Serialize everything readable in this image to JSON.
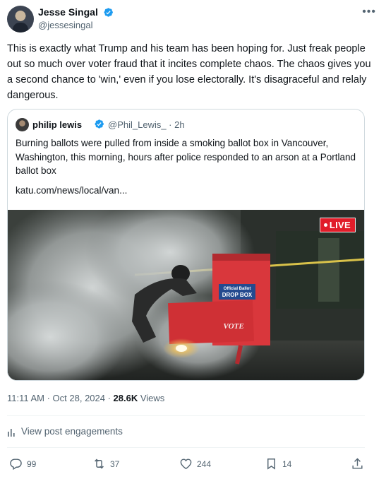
{
  "author": {
    "name": "Jesse Singal",
    "handle": "@jessesingal",
    "verified": true
  },
  "tweet": {
    "text": "This is exactly what Trump and his team has been hoping for. Just freak people out so much over voter fraud that it incites complete chaos. The chaos gives you a second chance to 'win,' even if you lose electorally. It's disagraceful and relaly dangerous."
  },
  "quote": {
    "name": "philip lewis",
    "handle_time": "@Phil_Lewis_ · 2h",
    "verified": true,
    "text": "Burning ballots were pulled from inside a smoking ballot box in Vancouver, Washington, this morning, hours after police responded to an arson at a Portland ballot box",
    "link": "katu.com/news/local/van...",
    "media": {
      "live_label": "LIVE",
      "box_label_1": "Official Ballot",
      "box_label_2": "DROP BOX",
      "box_label_3": "VOTE"
    }
  },
  "meta": {
    "time_date": "11:11 AM · Oct 28, 2024 · ",
    "views_count": "28.6K",
    "views_label": " Views"
  },
  "engagements_label": "View post engagements",
  "actions": {
    "replies": "99",
    "reposts": "37",
    "likes": "244",
    "bookmarks": "14"
  },
  "colors": {
    "verified_blue": "#1d9bf0",
    "text_secondary": "#536471",
    "live_red": "#e11d2a",
    "ballot_box_red": "#d9373c"
  },
  "icons": [
    "more-icon",
    "verified-badge-icon",
    "reply-icon",
    "repost-icon",
    "like-icon",
    "bookmark-icon",
    "share-icon",
    "analytics-icon"
  ]
}
